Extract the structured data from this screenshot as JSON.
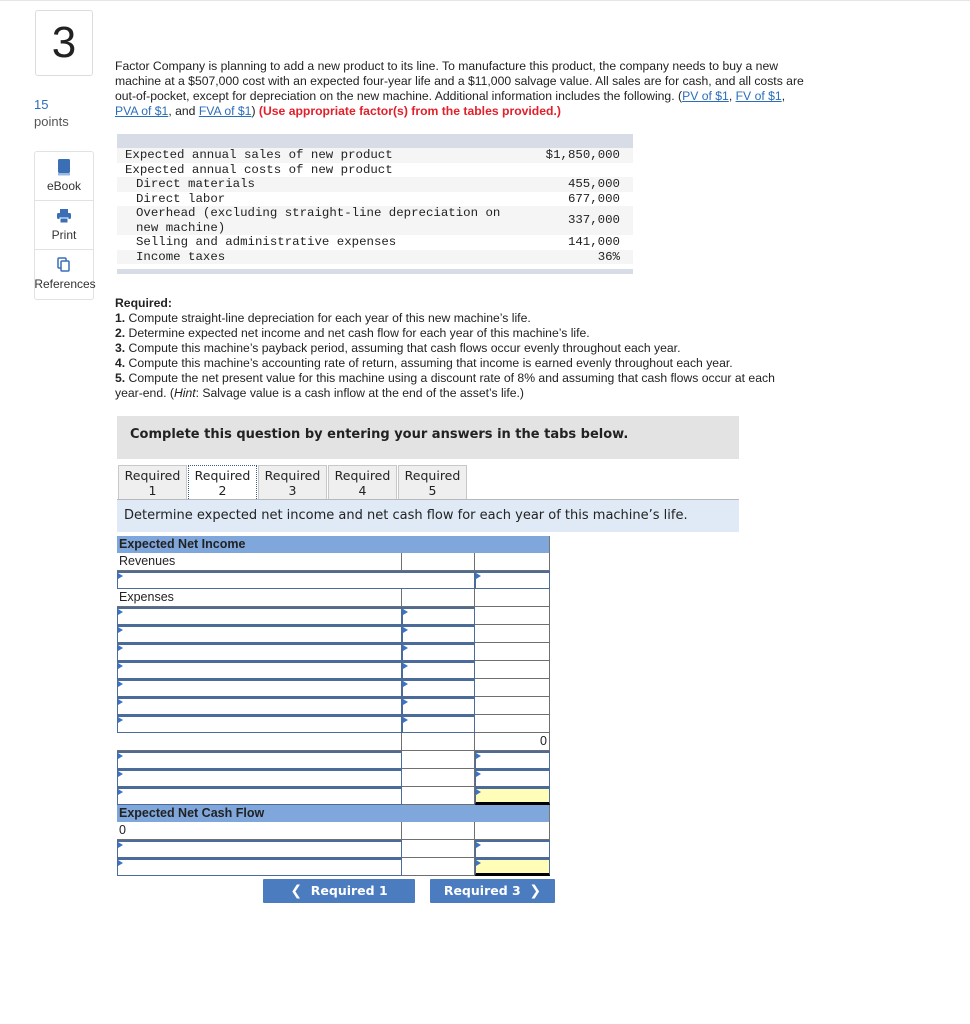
{
  "question": {
    "number": "3",
    "points_value": "15",
    "points_label": "points"
  },
  "side_tools": [
    {
      "label": "eBook",
      "icon": "book-icon"
    },
    {
      "label": "Print",
      "icon": "printer-icon"
    },
    {
      "label": "References",
      "icon": "copy-icon"
    }
  ],
  "problem": {
    "text": "Factor Company is planning to add a new product to its line. To manufacture this product, the company needs to buy a new machine at a $507,000 cost with an expected four-year life and a $11,000 salvage value. All sales are for cash, and all costs are out-of-pocket, except for depreciation on the new machine. Additional information includes the following.",
    "links": [
      "PV of $1",
      "FV of $1",
      "PVA of $1",
      "FVA of $1"
    ],
    "link_sep1": ", ",
    "link_sep2": ", ",
    "link_sep3": ", and ",
    "open_paren": "(",
    "close_paren": ")",
    "instruction": "(Use appropriate factor(s) from the tables provided.)"
  },
  "given": [
    {
      "label": "Expected annual sales of new product",
      "value": "$1,850,000",
      "indent": false
    },
    {
      "label": "Expected annual costs of new product",
      "value": "",
      "indent": false
    },
    {
      "label": "Direct materials",
      "value": "455,000",
      "indent": true
    },
    {
      "label": "Direct labor",
      "value": "677,000",
      "indent": true
    },
    {
      "label": "Overhead (excluding straight-line depreciation on new machine)",
      "value": "337,000",
      "indent": true
    },
    {
      "label": "Selling and administrative expenses",
      "value": "141,000",
      "indent": true
    },
    {
      "label": "Income taxes",
      "value": "36%",
      "indent": true
    }
  ],
  "required": {
    "heading": "Required:",
    "items": [
      {
        "num": "1.",
        "text": " Compute straight-line depreciation for each year of this new machine’s life."
      },
      {
        "num": "2.",
        "text": " Determine expected net income and net cash flow for each year of this machine’s life."
      },
      {
        "num": "3.",
        "text": " Compute this machine’s payback period, assuming that cash flows occur evenly throughout each year."
      },
      {
        "num": "4.",
        "text": " Compute this machine’s accounting rate of return, assuming that income is earned evenly throughout each year."
      },
      {
        "num": "5.",
        "text": " Compute the net present value for this machine using a discount rate of 8% and assuming that cash flows occur at each year-end. ("
      }
    ],
    "hint_label": "Hint",
    "hint_text": ": Salvage value is a cash inflow at the end of the asset’s life.)"
  },
  "instruction_box": "Complete this question by entering your answers in the tabs below.",
  "tabs": [
    {
      "line1": "Required",
      "line2": "1",
      "active": false
    },
    {
      "line1": "Required",
      "line2": "2",
      "active": true
    },
    {
      "line1": "Required",
      "line2": "3",
      "active": false
    },
    {
      "line1": "Required",
      "line2": "4",
      "active": false
    },
    {
      "line1": "Required",
      "line2": "5",
      "active": false
    }
  ],
  "prompt": "Determine expected net income and net cash flow for each year of this machine’s life.",
  "worksheet": {
    "net_income_header": "Expected Net Income",
    "revenues_label": "Revenues",
    "expenses_label": "Expenses",
    "total_expenses_value": "0",
    "net_cash_flow_header": "Expected Net Cash Flow",
    "cash_flow_first_value": "0"
  },
  "nav": {
    "prev_label": "Required 1",
    "next_label": "Required 3"
  }
}
